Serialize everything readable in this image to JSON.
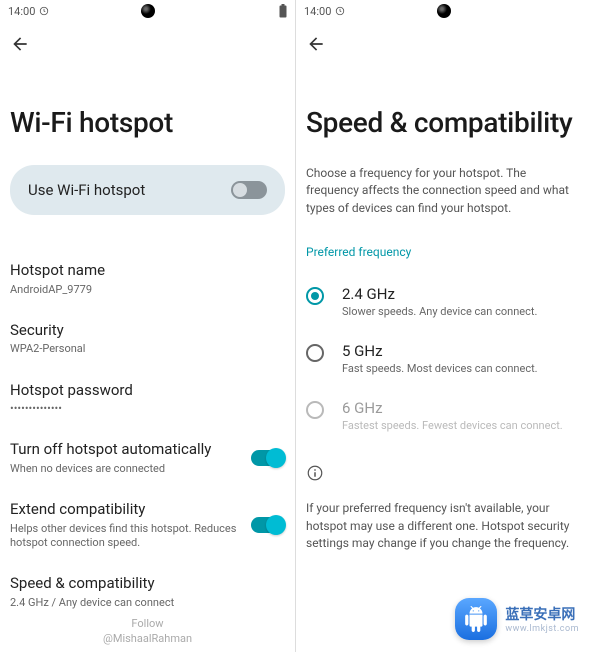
{
  "status": {
    "time": "14:00"
  },
  "left": {
    "title": "Wi-Fi hotspot",
    "use_label": "Use Wi-Fi hotspot",
    "items": {
      "name": {
        "title": "Hotspot name",
        "sub": "AndroidAP_9779"
      },
      "security": {
        "title": "Security",
        "sub": "WPA2-Personal"
      },
      "password": {
        "title": "Hotspot password",
        "sub": "••••••••••••••"
      },
      "auto_off": {
        "title": "Turn off hotspot automatically",
        "sub": "When no devices are connected"
      },
      "extend": {
        "title": "Extend compatibility",
        "sub": "Helps other devices find this hotspot. Reduces hotspot connection speed."
      },
      "speed": {
        "title": "Speed & compatibility",
        "sub": "2.4 GHz / Any device can connect"
      }
    },
    "credit": {
      "line1": "Follow",
      "line2": "@MishaalRahman"
    }
  },
  "right": {
    "title": "Speed & compatibility",
    "description": "Choose a frequency for your hotspot. The frequency affects the connection speed and what types of devices can find your hotspot.",
    "section_label": "Preferred frequency",
    "options": [
      {
        "title": "2.4 GHz",
        "sub": "Slower speeds. Any device can connect."
      },
      {
        "title": "5 GHz",
        "sub": "Fast speeds. Most devices can connect."
      },
      {
        "title": "6 GHz",
        "sub": "Fastest speeds. Fewest devices can connect."
      }
    ],
    "info": "If your preferred frequency isn't available, your hotspot may use a different one. Hotspot security settings may change if you change the frequency."
  },
  "watermark": {
    "line1": "蓝草安卓网",
    "line2": "www.lmkjst.com"
  }
}
